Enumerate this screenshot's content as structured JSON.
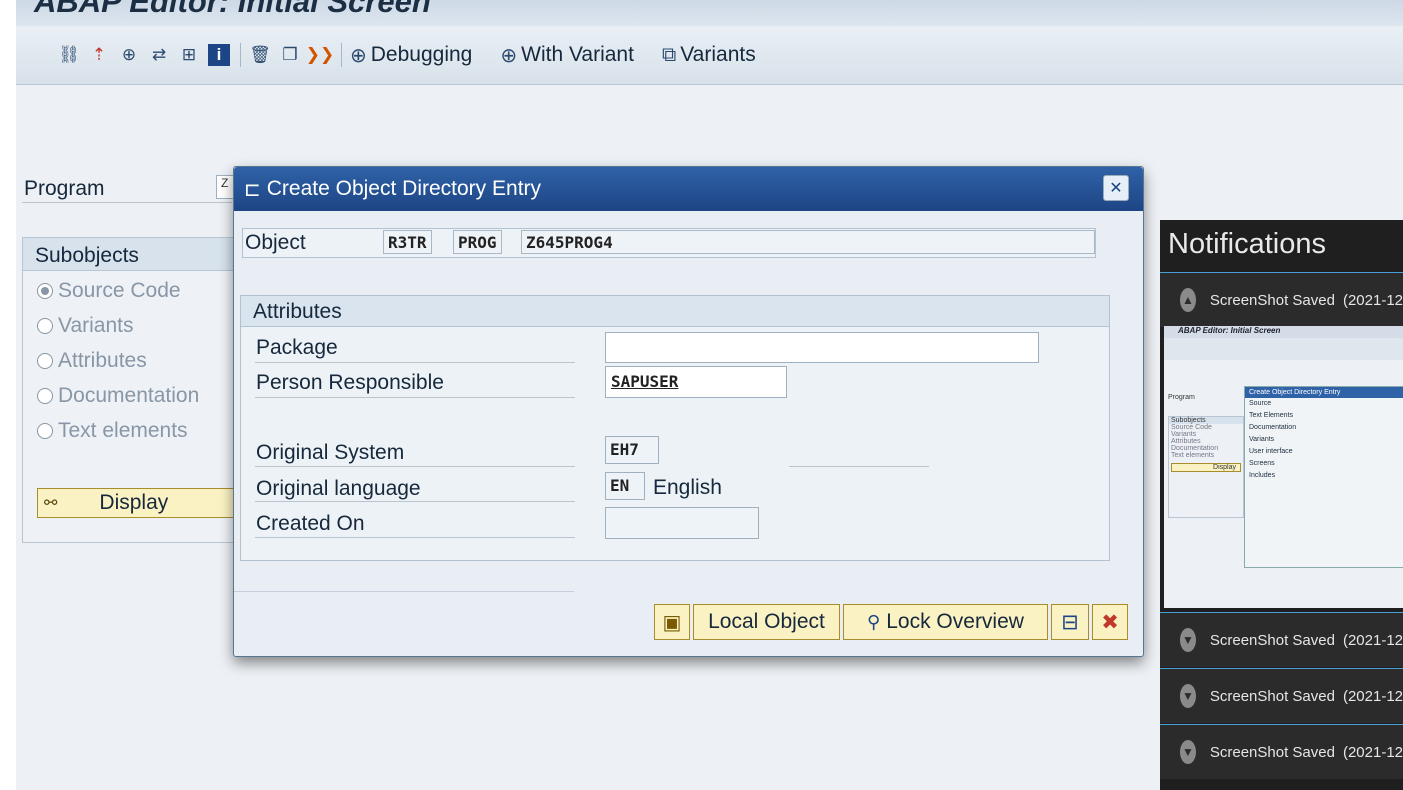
{
  "window": {
    "title": "ABAP Editor: Initial Screen"
  },
  "toolbar": {
    "icons": [
      "object-list-icon",
      "where-used-icon",
      "execute-icon",
      "navigate-icon",
      "hierarchy-icon",
      "info-icon",
      "delete-icon",
      "copy-icon",
      "rename-icon"
    ],
    "debugging_label": "Debugging",
    "with_variant_label": "With Variant",
    "variants_label": "Variants"
  },
  "main": {
    "program_label": "Program",
    "program_value": "Z",
    "subobjects": {
      "title": "Subobjects",
      "options": [
        {
          "label": "Source Code",
          "selected": true
        },
        {
          "label": "Variants",
          "selected": false
        },
        {
          "label": "Attributes",
          "selected": false
        },
        {
          "label": "Documentation",
          "selected": false
        },
        {
          "label": "Text elements",
          "selected": false
        }
      ],
      "display_label": "Display"
    }
  },
  "dialog": {
    "title": "Create Object Directory Entry",
    "object_label": "Object",
    "object_pgmid": "R3TR",
    "object_type": "PROG",
    "object_name": "Z645PROG4",
    "attributes_title": "Attributes",
    "package_label": "Package",
    "package_value": "",
    "person_label": "Person Responsible",
    "person_value": "SAPUSER",
    "orig_system_label": "Original System",
    "orig_system_value": "EH7",
    "orig_lang_label": "Original language",
    "orig_lang_code": "EN",
    "orig_lang_name": "English",
    "created_on_label": "Created On",
    "created_on_value": "",
    "local_object_label": "Local Object",
    "lock_overview_label": "Lock Overview"
  },
  "notifications": {
    "title": "Notifications",
    "items": [
      {
        "label": "ScreenShot Saved",
        "time": "(2021-12",
        "expanded": true
      },
      {
        "label": "ScreenShot Saved",
        "time": "(2021-12",
        "expanded": false
      },
      {
        "label": "ScreenShot Saved",
        "time": "(2021-12",
        "expanded": false
      },
      {
        "label": "ScreenShot Saved",
        "time": "(2021-12",
        "expanded": false
      }
    ],
    "thumbnail": {
      "title": "ABAP Editor: Initial Screen",
      "program": "Program",
      "dialog_title": "Create Object Directory Entry",
      "subobjects": "Subobjects",
      "left_options": [
        "Source Code",
        "Variants",
        "Attributes",
        "Documentation",
        "Text elements"
      ],
      "display": "Display",
      "checks": [
        "Source",
        "Text Elements",
        "Documentation",
        "Variants",
        "User interface",
        "Screens",
        "Includes"
      ]
    }
  }
}
